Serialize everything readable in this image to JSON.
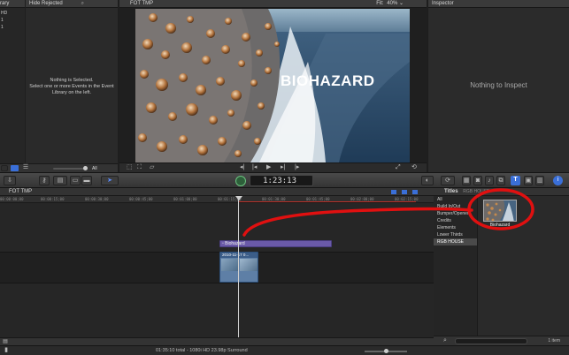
{
  "library": {
    "title_partial": "rary",
    "items": [
      "HD",
      "1",
      "1"
    ]
  },
  "event_browser": {
    "title": "Hide Rejected",
    "message_line1": "Nothing is Selected.",
    "message_line2": "Select one or more Events in the Event",
    "message_line3": "Library on the left.",
    "filter_value": "All"
  },
  "viewer": {
    "title": "FOT TMP",
    "fit_label": "Fit:",
    "fit_value": "40%",
    "overlay_text": "BIOHAZARD"
  },
  "inspector": {
    "title": "Inspector",
    "empty_text": "Nothing to Inspect"
  },
  "toolbar": {
    "timecode": "1:23:13"
  },
  "timeline": {
    "project_title": "FOT TMP",
    "ruler": [
      "00:00:00;00",
      "00:00:15;00",
      "00:00:30;00",
      "00:00:45;00",
      "00:01:00;00",
      "00:01:15;00",
      "00:01:30;00",
      "00:01:45;00",
      "00:02:00;00",
      "00:02:15;00"
    ],
    "title_clip": "Biohazard",
    "video_clip": "2010-11-17 0..."
  },
  "titles_browser": {
    "title": "Titles",
    "subtitle": "RGB HOUSE",
    "categories": [
      "All",
      "Build In/Out",
      "Bumper/Opener",
      "Credits",
      "Elements",
      "Lower Thirds",
      "RGB HOUSE"
    ],
    "selected_category": "RGB HOUSE",
    "thumb_label": "Biohazard",
    "count": "1 item"
  },
  "status_bar": {
    "text": "01:35:10 total - 1080i HD 23.98p Surround"
  },
  "colors": {
    "annotation": "#e01010",
    "timeline_title_clip": "#6a5aa8",
    "playhead": "#d0d0d0"
  }
}
